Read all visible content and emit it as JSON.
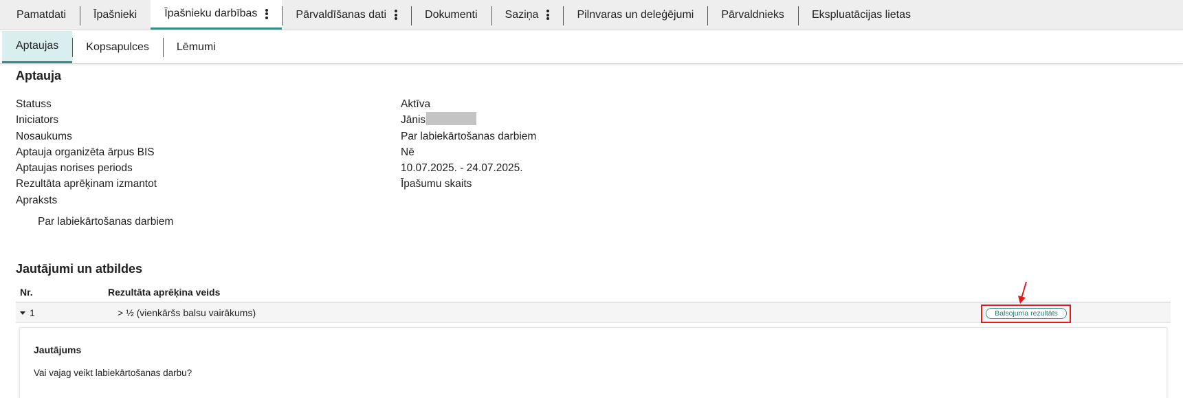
{
  "top_tabs": [
    {
      "label": "Pamatdati",
      "has_menu": false
    },
    {
      "label": "Īpašnieki",
      "has_menu": false
    },
    {
      "label": "Īpašnieku darbības",
      "has_menu": true
    },
    {
      "label": "Pārvaldīšanas dati",
      "has_menu": true
    },
    {
      "label": "Dokumenti",
      "has_menu": false
    },
    {
      "label": "Saziņa",
      "has_menu": true
    },
    {
      "label": "Pilnvaras un deleģējumi",
      "has_menu": false
    },
    {
      "label": "Pārvaldnieks",
      "has_menu": false
    },
    {
      "label": "Ekspluatācijas lietas",
      "has_menu": false
    }
  ],
  "sub_tabs": [
    {
      "label": "Aptaujas"
    },
    {
      "label": "Kopsapulces"
    },
    {
      "label": "Lēmumi"
    }
  ],
  "survey": {
    "title": "Aptauja",
    "fields": [
      {
        "label": "Statuss",
        "value": "Aktīva"
      },
      {
        "label": "Iniciators",
        "value": "Jānis"
      },
      {
        "label": "Nosaukums",
        "value": "Par labiekārtošanas darbiem"
      },
      {
        "label": "Aptauja organizēta ārpus BIS",
        "value": "Nē"
      },
      {
        "label": "Aptaujas norises periods",
        "value": "10.07.2025. - 24.07.2025."
      },
      {
        "label": "Rezultāta aprēķinam izmantot",
        "value": "Īpašumu skaits"
      },
      {
        "label": "Apraksts",
        "value": ""
      }
    ],
    "description": "Par labiekārtošanas darbiem"
  },
  "questions": {
    "title": "Jautājumi un atbildes",
    "headers": {
      "nr": "Nr.",
      "calc_type": "Rezultāta aprēķina veids"
    },
    "rows": [
      {
        "nr": "1",
        "calc_type": "> ½ (vienkāršs balsu vairākums)",
        "button": "Balsojuma rezultāts"
      }
    ],
    "card": {
      "title": "Jautājums",
      "text": "Vai vajag veikt labiekārtošanas darbu?"
    }
  },
  "colors": {
    "accent": "#3b8a8a",
    "highlight": "#e01b1b"
  }
}
